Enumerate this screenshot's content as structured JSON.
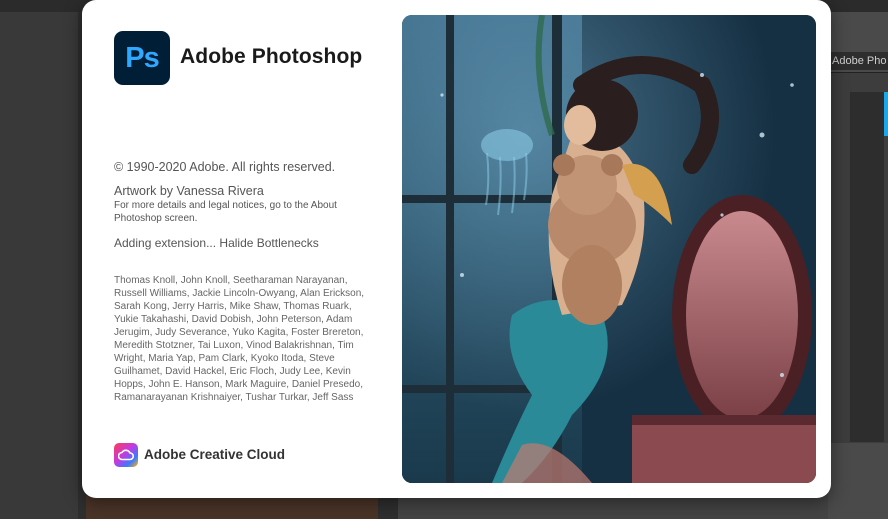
{
  "background": {
    "right_tab_label": "Adobe Pho"
  },
  "splash": {
    "app_icon_text": "Ps",
    "app_title": "Adobe Photoshop",
    "copyright": "© 1990-2020 Adobe. All rights reserved.",
    "artwork_credit": "Artwork by Vanessa Rivera",
    "legal_notice": "For more details and legal notices, go to the About Photoshop screen.",
    "status": "Adding extension... Halide Bottlenecks",
    "credits": "Thomas Knoll, John Knoll, Seetharaman Narayanan, Russell Williams, Jackie Lincoln-Owyang, Alan Erickson, Sarah Kong, Jerry Harris, Mike Shaw, Thomas Ruark, Yukie Takahashi, David Dobish, John Peterson, Adam Jerugim, Judy Severance, Yuko Kagita, Foster Brereton, Meredith Stotzner, Tai Luxon, Vinod Balakrishnan, Tim Wright, Maria Yap, Pam Clark, Kyoko Itoda, Steve Guilhamet, David Hackel, Eric Floch, Judy Lee, Kevin Hopps, John E. Hanson, Mark Maguire, Daniel Presedo, Ramanarayanan Krishnaiyer, Tushar Turkar, Jeff Sass",
    "footer_brand": "Adobe Creative Cloud"
  },
  "colors": {
    "ps_icon_bg": "#001e36",
    "ps_icon_fg": "#31a8ff",
    "accent_blue": "#1ea7e8"
  },
  "icons": {
    "app_icon": "photoshop-logo-icon",
    "footer_icon": "creative-cloud-icon"
  }
}
